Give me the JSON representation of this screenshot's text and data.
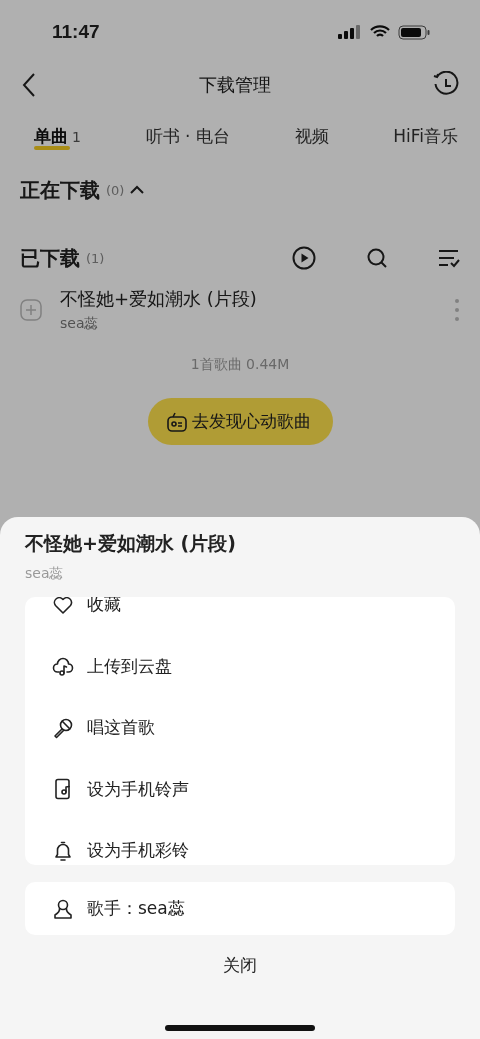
{
  "status_bar": {
    "time": "11:47"
  },
  "nav": {
    "title": "下载管理"
  },
  "tabs": [
    {
      "label": "单曲",
      "count": "1",
      "selected": true
    },
    {
      "label": "听书 · 电台",
      "selected": false
    },
    {
      "label": "视频",
      "selected": false
    },
    {
      "label": "HiFi音乐",
      "selected": false
    }
  ],
  "downloading": {
    "title": "正在下载",
    "count": "(0)"
  },
  "downloaded": {
    "title": "已下载",
    "count": "(1)"
  },
  "songs": [
    {
      "title": "不怪她+爱如潮水 (片段)",
      "artist": "sea蕊"
    }
  ],
  "summary": "1首歌曲 0.44M",
  "discover_button": "去发现心动歌曲",
  "sheet": {
    "title": "不怪她+爱如潮水 (片段)",
    "artist": "sea蕊",
    "actions": [
      {
        "label": "收藏"
      },
      {
        "label": "上传到云盘"
      },
      {
        "label": "唱这首歌"
      },
      {
        "label": "设为手机铃声"
      },
      {
        "label": "设为手机彩铃"
      }
    ],
    "singer": "歌手：sea蕊",
    "close": "关闭"
  }
}
